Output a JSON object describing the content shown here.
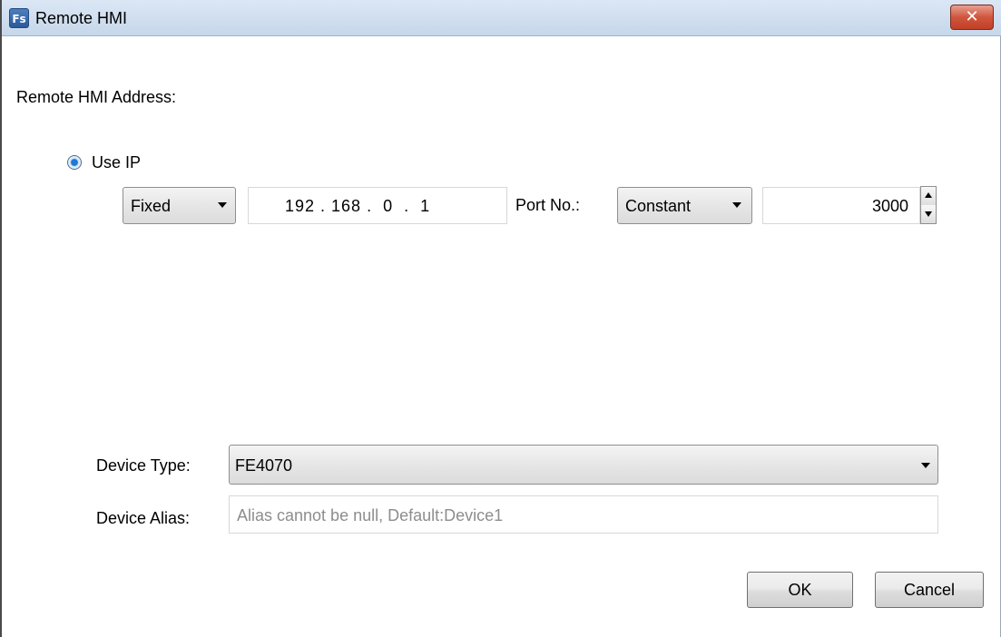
{
  "window": {
    "title": "Remote HMI",
    "app_icon_text": "Fs",
    "close_glyph": "✕"
  },
  "address": {
    "section_label": "Remote HMI Address:",
    "use_ip_label": "Use IP",
    "use_ip_selected": true,
    "ip_mode": "Fixed",
    "ip_value": "192 . 168 .  0  .  1",
    "port_label": "Port No.:",
    "port_mode": "Constant",
    "port_value": "3000"
  },
  "device": {
    "type_label": "Device Type:",
    "type_value": "FE4070",
    "alias_label": "Device Alias:",
    "alias_placeholder": "Alias cannot be null, Default:Device1"
  },
  "buttons": {
    "ok": "OK",
    "cancel": "Cancel"
  },
  "colors": {
    "title_bar": "#c6d7ea",
    "close_button": "#c13f27",
    "radio_selected": "#1e78d8"
  }
}
